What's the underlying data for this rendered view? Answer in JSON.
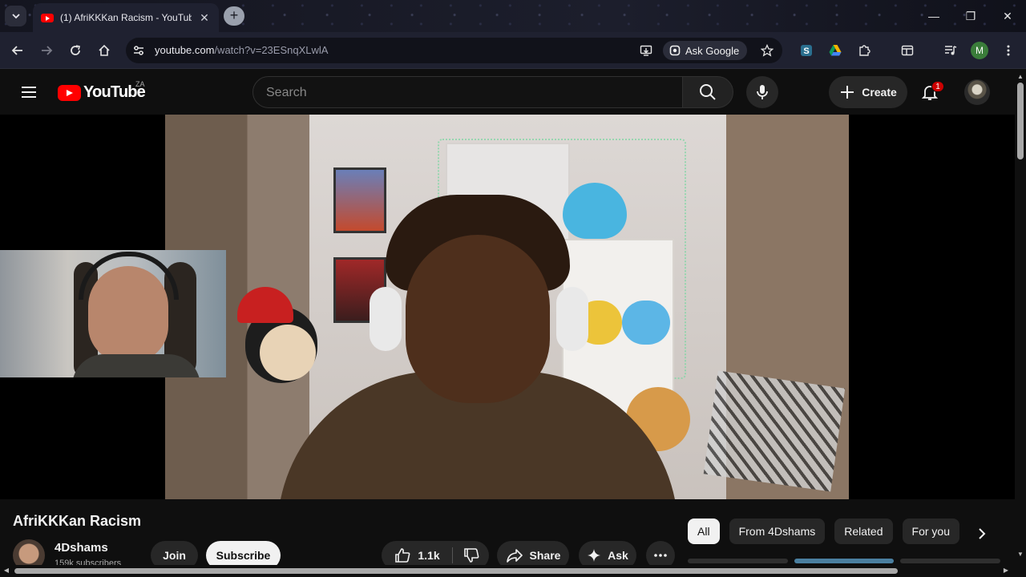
{
  "browser": {
    "tab_title": "(1) AfriKKKan Racism - YouTube",
    "url_host": "youtube.com",
    "url_path": "/watch?v=23ESnqXLwlA",
    "ask_google_label": "Ask Google",
    "profile_initial": "M"
  },
  "header": {
    "logo_text": "YouTube",
    "country_code": "ZA",
    "search_placeholder": "Search",
    "create_label": "Create",
    "notification_count": "1"
  },
  "video": {
    "title": "AfriKKKan Racism",
    "channel_name": "4Dshams",
    "channel_subscribers": "159k subscribers",
    "join_label": "Join",
    "subscribe_label": "Subscribe",
    "like_count": "1.1k",
    "share_label": "Share",
    "ask_label": "Ask"
  },
  "chips": [
    {
      "label": "All",
      "active": true
    },
    {
      "label": "From 4Dshams",
      "active": false
    },
    {
      "label": "Related",
      "active": false
    },
    {
      "label": "For you",
      "active": false
    }
  ],
  "colors": {
    "brand_red": "#ff0000",
    "background": "#0f0f0f",
    "pill_bg": "#272727"
  }
}
